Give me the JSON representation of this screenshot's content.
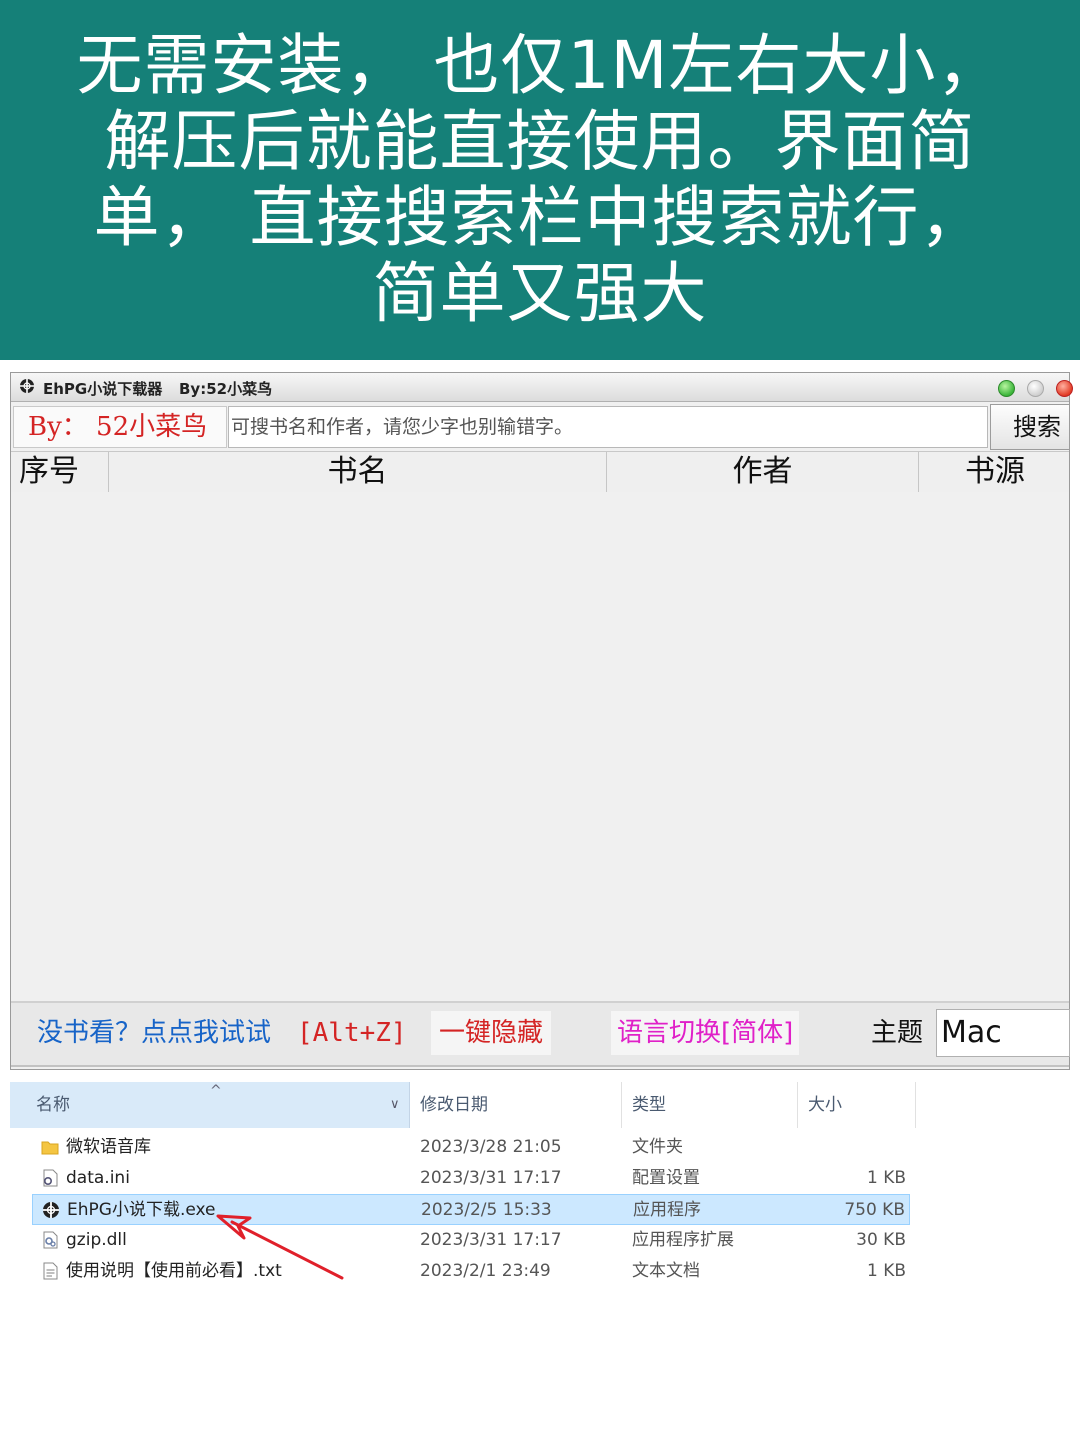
{
  "banner": {
    "line1": "无需安装，  也仅1M左右大小，",
    "line2": "解压后就能直接使用。界面简",
    "line3": "单，  直接搜索栏中搜索就行，",
    "line4": "简单又强大"
  },
  "app": {
    "title": "EhPG小说下载器",
    "title_by": "By:52小菜鸟",
    "by_label": "By：  52小菜鸟",
    "search_placeholder": "可搜书名和作者，请您少字也别输错字。",
    "search_button": "搜索",
    "columns": [
      "序号",
      "书名",
      "作者",
      "书源"
    ],
    "bottom": {
      "tip": "没书看？点点我试试",
      "hotkey": "[Alt+Z]",
      "hide": "一键隐藏",
      "language": "语言切换[简体]",
      "theme_label": "主题",
      "theme_value": "Mac"
    }
  },
  "explorer": {
    "headers": {
      "name": "名称",
      "date": "修改日期",
      "type": "类型",
      "size": "大小"
    },
    "files": [
      {
        "name": "微软语音库",
        "date": "2023/3/28 21:05",
        "type": "文件夹",
        "size": "",
        "icon": "folder-icon"
      },
      {
        "name": "data.ini",
        "date": "2023/3/31 17:17",
        "type": "配置设置",
        "size": "1 KB",
        "icon": "settings-file-icon"
      },
      {
        "name": "EhPG小说下载.exe",
        "date": "2023/2/5 15:33",
        "type": "应用程序",
        "size": "750 KB",
        "icon": "app-icon"
      },
      {
        "name": "gzip.dll",
        "date": "2023/3/31 17:17",
        "type": "应用程序扩展",
        "size": "30 KB",
        "icon": "dll-file-icon"
      },
      {
        "name": "使用说明【使用前必看】.txt",
        "date": "2023/2/1 23:49",
        "type": "文本文档",
        "size": "1 KB",
        "icon": "text-file-icon"
      }
    ]
  },
  "colors": {
    "banner_bg": "#158078",
    "accent_red": "#d42424",
    "accent_blue": "#1764c8",
    "accent_magenta": "#e020c8",
    "selection": "#cce8ff"
  }
}
